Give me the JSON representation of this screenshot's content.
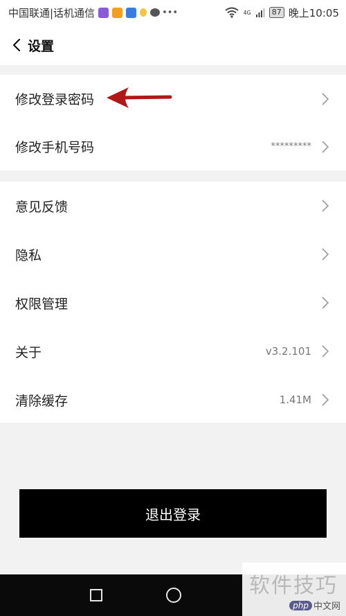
{
  "status_bar": {
    "carrier": "中国联通|话机通信",
    "network": "4G",
    "battery": "87",
    "time": "晚上10:05"
  },
  "nav": {
    "title": "设置"
  },
  "groups": {
    "account": [
      {
        "label": "修改登录密码"
      },
      {
        "label": "修改手机号码",
        "value": "*********"
      }
    ],
    "general": [
      {
        "label": "意见反馈"
      },
      {
        "label": "隐私"
      },
      {
        "label": "权限管理"
      },
      {
        "label": "关于",
        "value": "v3.2.101"
      },
      {
        "label": "清除缓存",
        "value": "1.41M"
      }
    ]
  },
  "logout_label": "退出登录",
  "watermark": {
    "text": "软件技巧",
    "logo_badge": "php",
    "logo_text": "中文网"
  },
  "colors": {
    "annotation_arrow": "#b01818",
    "logout_bg": "#000000",
    "page_bg": "#f2f2f2"
  }
}
